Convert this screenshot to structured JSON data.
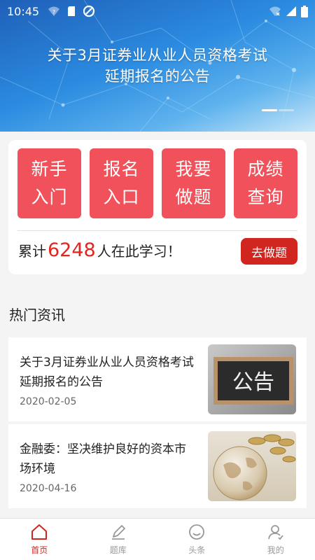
{
  "status_bar": {
    "time": "10:45",
    "left_icons": [
      "wifi-question-icon",
      "sim-card-icon",
      "app-notification-icon"
    ],
    "right_icons": [
      "wifi-off-icon",
      "signal-icon",
      "battery-icon"
    ]
  },
  "banner": {
    "title_line1": "关于3月证券业从业人员资格考试",
    "title_line2": "延期报名的公告",
    "slide_count": 2,
    "active_slide": 1
  },
  "quick_actions": [
    {
      "line1": "新手",
      "line2": "入门"
    },
    {
      "line1": "报名",
      "line2": "入口"
    },
    {
      "line1": "我要",
      "line2": "做题"
    },
    {
      "line1": "成绩",
      "line2": "查询"
    }
  ],
  "study": {
    "prefix": "累计",
    "count": "6248",
    "suffix": "人在此学习！",
    "button_label": "去做题"
  },
  "hot_news": {
    "title": "热门资讯",
    "items": [
      {
        "title": "关于3月证券业从业人员资格考试延期报名的公告",
        "date": "2020-02-05",
        "thumb_text": "公告"
      },
      {
        "title": "金融委：坚决维护良好的资本市场环境",
        "date": "2020-04-16"
      }
    ]
  },
  "tabbar": {
    "items": [
      {
        "label": "首页",
        "icon": "home-icon",
        "active": true
      },
      {
        "label": "题库",
        "icon": "pencil-icon",
        "active": false
      },
      {
        "label": "头条",
        "icon": "smile-icon",
        "active": false
      },
      {
        "label": "我的",
        "icon": "user-icon",
        "active": false
      }
    ]
  },
  "colors": {
    "accent_red": "#d1261f",
    "tile_red": "#f0515a",
    "count_red": "#e0261e",
    "banner_blue": "#2b8be0"
  }
}
